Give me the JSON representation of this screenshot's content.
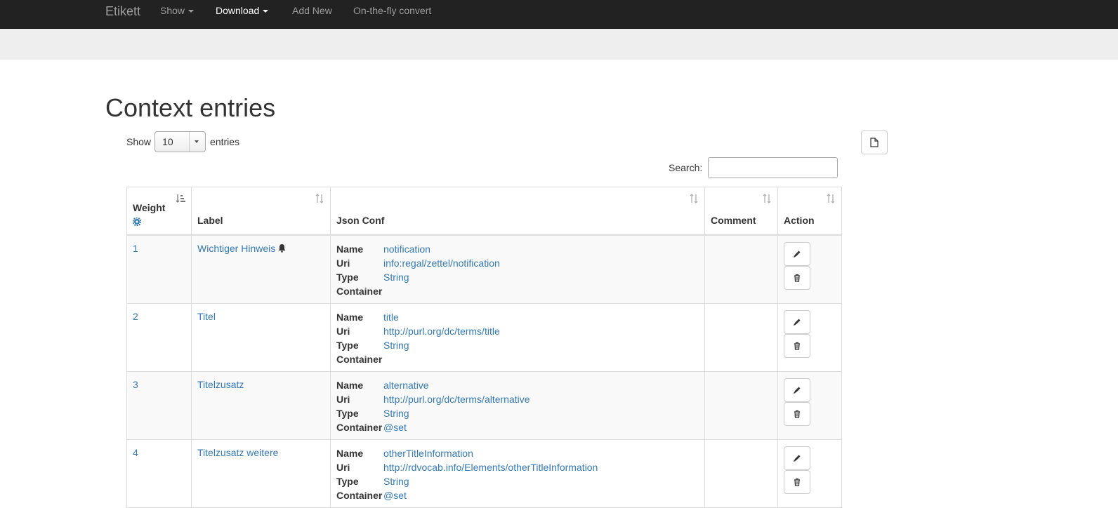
{
  "navbar": {
    "brand": "Etikett",
    "items": [
      {
        "label": "Show",
        "dropdown": true,
        "active": false
      },
      {
        "label": "Download",
        "dropdown": true,
        "active": true
      },
      {
        "label": "Add New",
        "dropdown": false,
        "active": false
      },
      {
        "label": "On-the-fly convert",
        "dropdown": false,
        "active": false
      }
    ]
  },
  "page": {
    "title": "Context entries",
    "length_prefix": "Show",
    "length_value": "10",
    "length_suffix": "entries",
    "search_label": "Search:",
    "search_value": ""
  },
  "table": {
    "columns": [
      "Weight",
      "Label",
      "Json Conf",
      "Comment",
      "Action"
    ],
    "conf_keys": [
      "Name",
      "Uri",
      "Type",
      "Container"
    ],
    "rows": [
      {
        "weight": "1",
        "label": "Wichtiger Hinweis",
        "icon": "bell-icon",
        "name": "notification",
        "uri": "info:regal/zettel/notification",
        "type": "String",
        "container": "",
        "comment": ""
      },
      {
        "weight": "2",
        "label": "Titel",
        "name": "title",
        "uri": "http://purl.org/dc/terms/title",
        "type": "String",
        "container": "",
        "comment": ""
      },
      {
        "weight": "3",
        "label": "Titelzusatz",
        "name": "alternative",
        "uri": "http://purl.org/dc/terms/alternative",
        "type": "String",
        "container": "@set",
        "comment": ""
      },
      {
        "weight": "4",
        "label": "Titelzusatz weitere",
        "name": "otherTitleInformation",
        "uri": "http://rdvocab.info/Elements/otherTitleInformation",
        "type": "String",
        "container": "@set",
        "comment": ""
      }
    ]
  },
  "colors": {
    "navbar_bg": "#222222",
    "link": "#337ab7",
    "subbar_bg": "#eeeeee",
    "stripe": "#f9f9f9"
  }
}
